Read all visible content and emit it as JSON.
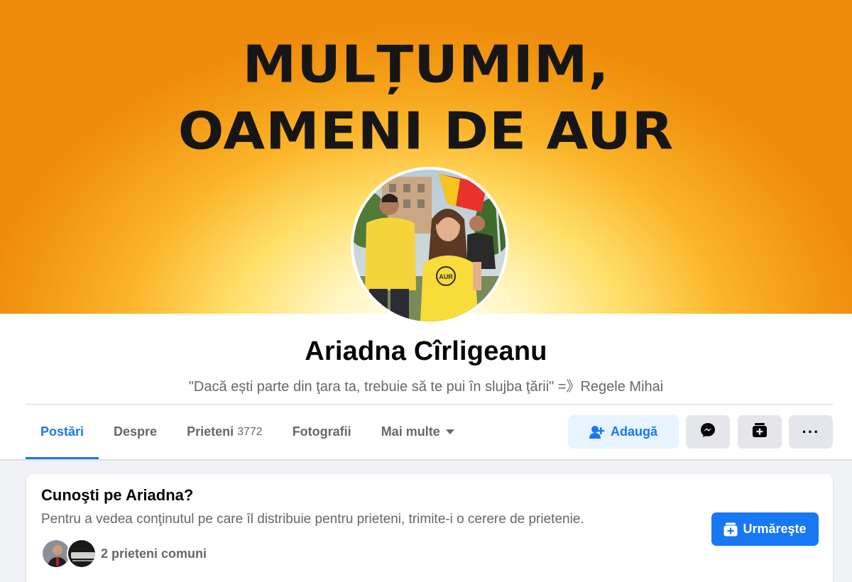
{
  "cover": {
    "line1": "MULȚUMIM,",
    "line2": "OAMENI DE AUR"
  },
  "profile": {
    "name": "Ariadna Cîrligeanu",
    "bio": "\"Dacă ești parte din ţara ta, trebuie să te pui în slujba ţării\" =》Regele Mihai"
  },
  "tabs": [
    {
      "label": "Postări",
      "active": true
    },
    {
      "label": "Despre"
    },
    {
      "label": "Prieteni",
      "count": "3772"
    },
    {
      "label": "Fotografii"
    },
    {
      "label": "Mai multe",
      "has_caret": true
    }
  ],
  "actions": {
    "add_label": "Adaugă",
    "add_icon": "add-friend-icon",
    "message_icon": "messenger-icon",
    "card_icon": "contact-card-icon",
    "more_icon": "more-dots-icon",
    "more_glyph": "···"
  },
  "card": {
    "title": "Cunoşti pe Ariadna?",
    "text": "Pentru a vedea conţinutul pe care îl distribuie pentru prieteni, trimite-i o cerere de prietenie.",
    "mutual_text": "2 prieteni comuni",
    "follow_label": "Urmăreşte",
    "follow_icon": "follow-icon"
  },
  "colors": {
    "accent": "#1877f2",
    "accent_light": "#e7f3ff",
    "secondary_text": "#65676b",
    "cover_orange": "#ef8c0c",
    "cover_yellow": "#ffdf6a"
  }
}
